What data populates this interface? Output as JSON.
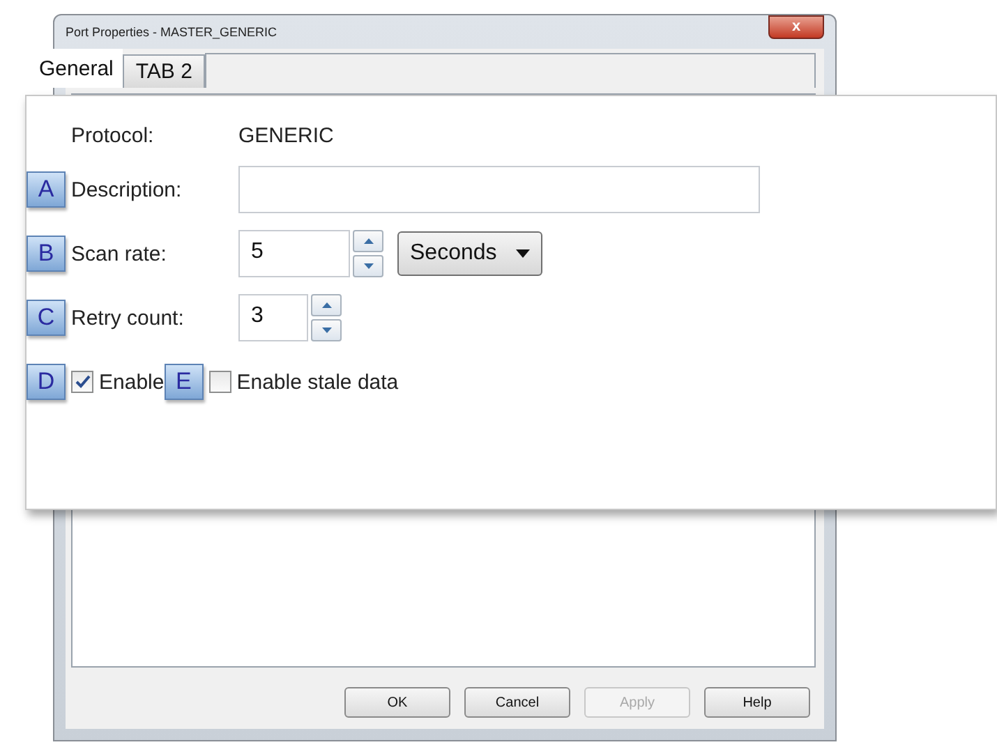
{
  "window": {
    "title": "Port Properties - MASTER_GENERIC",
    "close": "x"
  },
  "tabs": [
    {
      "label": "General",
      "selected": true
    },
    {
      "label": "TAB 2",
      "selected": false
    }
  ],
  "protocol": {
    "label": "Protocol:",
    "value": "GENERIC"
  },
  "description": {
    "badge": "A",
    "label": "Description:"
  },
  "scan_rate": {
    "badge": "B",
    "label": "Scan rate:",
    "value": "5",
    "unit": "Seconds"
  },
  "retry_count": {
    "badge": "C",
    "label": "Retry count:",
    "value": "3"
  },
  "checkboxes": [
    {
      "badge": "D",
      "label": "Enable",
      "checked": true
    },
    {
      "badge": "E",
      "label": "Enable stale data",
      "checked": false
    }
  ],
  "buttons": [
    {
      "label": "OK",
      "disabled": false
    },
    {
      "label": "Cancel",
      "disabled": false
    },
    {
      "label": "Apply",
      "disabled": true
    },
    {
      "label": "Help",
      "disabled": false
    }
  ]
}
